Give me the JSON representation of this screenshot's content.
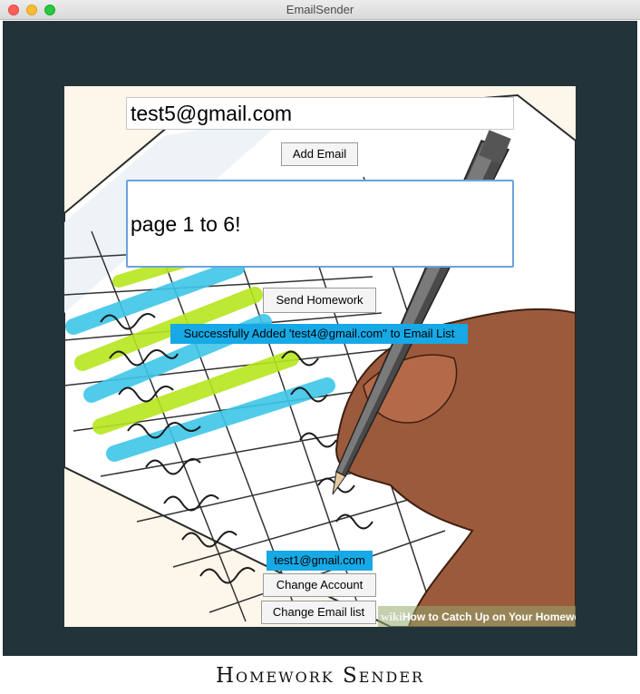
{
  "window": {
    "title": "EmailSender"
  },
  "form": {
    "email_value": "test5@gmail.com",
    "add_email_label": "Add Email",
    "message_value": "page 1 to 6!",
    "send_label": "Send Homework",
    "status_message": "Successfully Added 'test4@gmail.com'' to Email List",
    "account_email": "test1@gmail.com",
    "change_account_label": "Change Account",
    "change_list_label": "Change Email list"
  },
  "background": {
    "watermark_prefix": "wiki",
    "watermark_text": "How to Catch Up on Your Homewo"
  },
  "footer": {
    "title": "Homework Sender"
  },
  "colors": {
    "panel": "#22343a",
    "status_bg": "#16a9e6",
    "focus_border": "#6aa3dc"
  }
}
